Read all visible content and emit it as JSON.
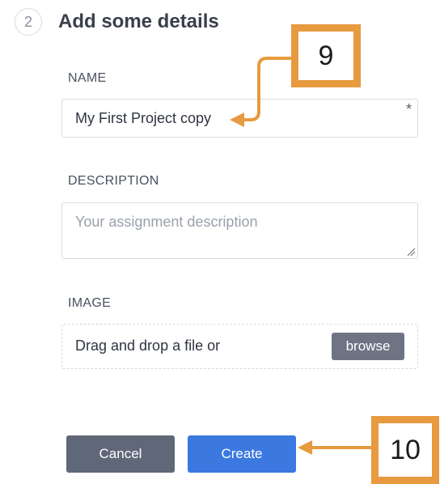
{
  "step": {
    "number": "2",
    "title": "Add some details"
  },
  "fields": {
    "name": {
      "label": "NAME",
      "value": "My First Project copy",
      "required_mark": "*"
    },
    "description": {
      "label": "DESCRIPTION",
      "placeholder": "Your assignment description"
    },
    "image": {
      "label": "IMAGE",
      "drop_text": "Drag and drop a file or",
      "browse_label": "browse"
    }
  },
  "buttons": {
    "cancel": "Cancel",
    "create": "Create"
  },
  "annotations": {
    "callout_9": "9",
    "callout_10": "10"
  },
  "colors": {
    "accent": "#e79a3f",
    "primary": "#3b78e0",
    "secondary": "#5f6779"
  }
}
